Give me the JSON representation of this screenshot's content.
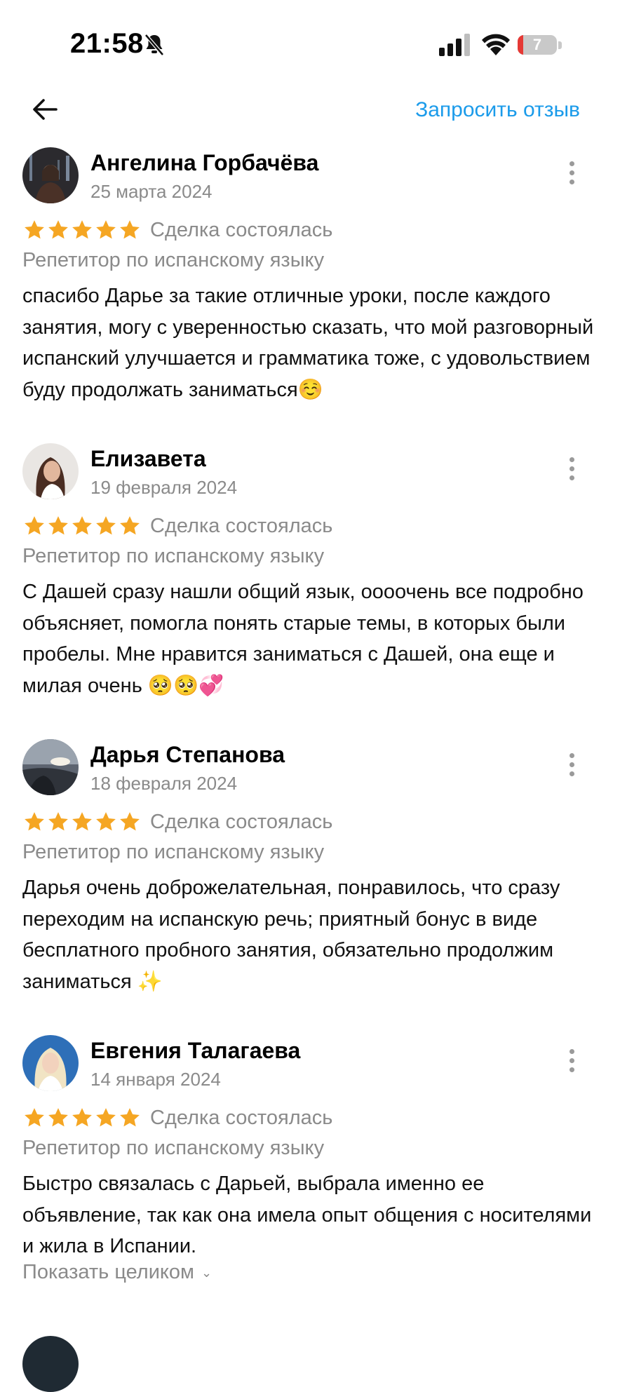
{
  "status_bar": {
    "time": "21:58",
    "battery": "7",
    "battery_color": "#e53935"
  },
  "header": {
    "request_review": "Запросить отзыв"
  },
  "accent_color": "#1b9bea",
  "star_color": "#f5a623",
  "reviews": [
    {
      "name": "Ангелина Горбачёва",
      "date": "25 марта 2024",
      "rating": 5,
      "deal": "Сделка состоялась",
      "category": "Репетитор по испанскому языку",
      "text": "спасибо Дарье за такие отличные уроки, после каждого занятия, могу с уверенностью сказать, что мой разговорный испанский улучшается и грамматика тоже, с удовольствием буду продолжать заниматься☺️"
    },
    {
      "name": "Елизавета",
      "date": "19 февраля 2024",
      "rating": 5,
      "deal": "Сделка состоялась",
      "category": "Репетитор по испанскому языку",
      "text": "С Дашей сразу нашли общий язык, оооочень все подробно объясняет, помогла понять старые темы, в которых были пробелы. Мне нравится заниматься с Дашей, она еще и милая очень 🥺🥺💞"
    },
    {
      "name": "Дарья Степанова",
      "date": "18 февраля 2024",
      "rating": 5,
      "deal": "Сделка состоялась",
      "category": "Репетитор по испанскому языку",
      "text": "Дарья очень доброжелательная, понравилось, что сразу переходим на испанскую речь; приятный бонус в виде бесплатного пробного занятия, обязательно продолжим заниматься ✨"
    },
    {
      "name": "Евгения Талагаева",
      "date": "14 января 2024",
      "rating": 5,
      "deal": "Сделка состоялась",
      "category": "Репетитор по испанскому языку",
      "text": "Быстро связалась с Дарьей, выбрала именно ее объявление, так как она имела опыт общения с носителями и жила в Испании.",
      "show_more": "Показать целиком"
    }
  ]
}
